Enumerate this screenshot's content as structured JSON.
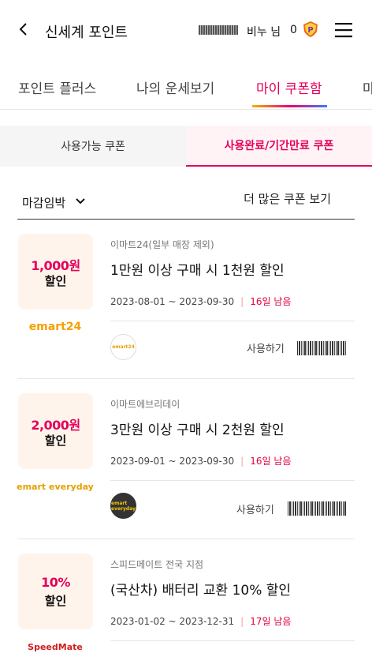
{
  "header": {
    "title": "신세계 포인트",
    "user_suffix": "비누 님",
    "points": "0"
  },
  "tabs": [
    {
      "label": "포인트 플러스"
    },
    {
      "label": "나의 운세보기"
    },
    {
      "label": "마이 쿠폰함"
    },
    {
      "label": "마"
    }
  ],
  "subtabs": [
    {
      "label": "사용가능 쿠폰"
    },
    {
      "label": "사용완료/기간만료 쿠폰"
    }
  ],
  "filter": {
    "sort_label": "마감임박",
    "more_label": "더 많은 쿠폰 보기"
  },
  "coupons": [
    {
      "badge_amount": "1,000원",
      "badge_suffix": "할인",
      "brand": "emart24",
      "store": "이마트24(일부 매장 제외)",
      "title": "1만원 이상 구매 시 1천원 할인",
      "period": "2023-08-01 ~ 2023-09-30",
      "days_left": "16일 남음",
      "store_icon_text": "emart24",
      "use_label": "사용하기"
    },
    {
      "badge_amount": "2,000원",
      "badge_suffix": "할인",
      "brand": "emart everyday",
      "store": "이마트에브리데이",
      "title": "3만원 이상 구매 시 2천원 할인",
      "period": "2023-09-01 ~ 2023-09-30",
      "days_left": "16일 남음",
      "store_icon_text": "emart everyday",
      "use_label": "사용하기"
    },
    {
      "badge_amount": "10%",
      "badge_suffix": "할인",
      "brand": "SpeedMate",
      "store": "스피드메이트 전국 지점",
      "title": "(국산차) 배터리 교환 10% 할인",
      "period": "2023-01-02 ~ 2023-12-31",
      "days_left": "17일 남음"
    }
  ],
  "colors": {
    "accent": "#e5005a",
    "days_left": "#e5003c",
    "badge_bg": "#fff4ec"
  }
}
